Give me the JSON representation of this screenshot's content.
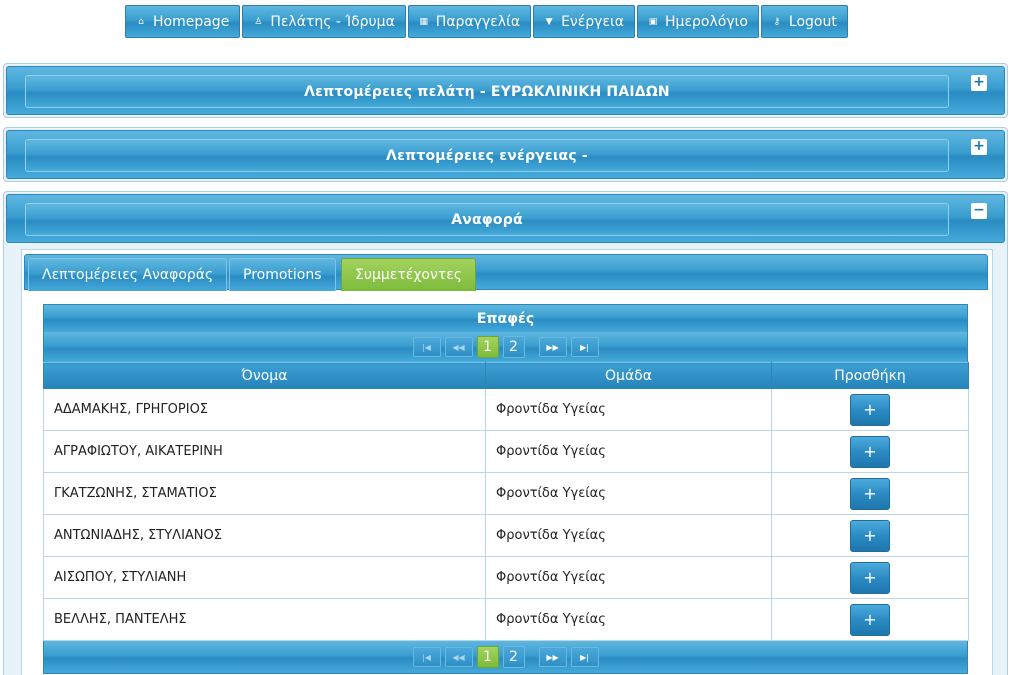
{
  "nav": [
    {
      "icon": "home-icon",
      "glyph": "⌂",
      "label": "Homepage"
    },
    {
      "icon": "user-icon",
      "glyph": "♙",
      "label": "Πελάτης - Ίδρυμα"
    },
    {
      "icon": "grid-icon",
      "glyph": "▦",
      "label": "Παραγγελία"
    },
    {
      "icon": "caret-down-icon",
      "glyph": "▼",
      "label": "Ενέργεια"
    },
    {
      "icon": "calendar-icon",
      "glyph": "▣",
      "label": "Ημερολόγιο"
    },
    {
      "icon": "key-icon",
      "glyph": "⚷",
      "label": "Logout"
    }
  ],
  "panels": {
    "customer": {
      "title": "Λεπτομέρειες πελάτη - ΕΥΡΩΚΛΙΝΙΚΗ ΠΑΙΔΩΝ",
      "toggle": "+"
    },
    "action": {
      "title": "Λεπτομέρειες ενέργειας -",
      "toggle": "+"
    },
    "report": {
      "title": "Αναφορά",
      "toggle": "−"
    }
  },
  "tabs": [
    {
      "label": "Λεπτομέρειες Αναφοράς",
      "active": false
    },
    {
      "label": "Promotions",
      "active": false
    },
    {
      "label": "Συμμετέχοντες",
      "active": true
    }
  ],
  "contacts": {
    "caption": "Επαφές",
    "pager": {
      "first": "|◀",
      "prev": "◀◀",
      "next": "▶▶",
      "last": "▶|",
      "pages": [
        "1",
        "2"
      ],
      "current": "1"
    },
    "columns": [
      "Όνομα",
      "Ομάδα",
      "Προσθήκη"
    ],
    "add_label": "+",
    "rows": [
      {
        "name": "ΑΔΑΜΑΚΗΣ, ΓΡΗΓΟΡΙΟΣ",
        "group": "Φροντίδα Υγείας"
      },
      {
        "name": "ΑΓΡΑΦΙΩΤΟΥ, ΑΙΚΑΤΕΡΙΝΗ",
        "group": "Φροντίδα Υγείας"
      },
      {
        "name": "ΓΚΑΤΖΩΝΗΣ, ΣΤΑΜΑΤΙΟΣ",
        "group": "Φροντίδα Υγείας"
      },
      {
        "name": "ΑΝΤΩΝΙΑΔΗΣ, ΣΤΥΛΙΑΝΟΣ",
        "group": "Φροντίδα Υγείας"
      },
      {
        "name": "ΑΙΣΩΠΟΥ, ΣΤΥΛΙΑΝΗ",
        "group": "Φροντίδα Υγείας"
      },
      {
        "name": "ΒΕΛΛΗΣ, ΠΑΝΤΕΛΗΣ",
        "group": "Φροντίδα Υγείας"
      }
    ]
  }
}
